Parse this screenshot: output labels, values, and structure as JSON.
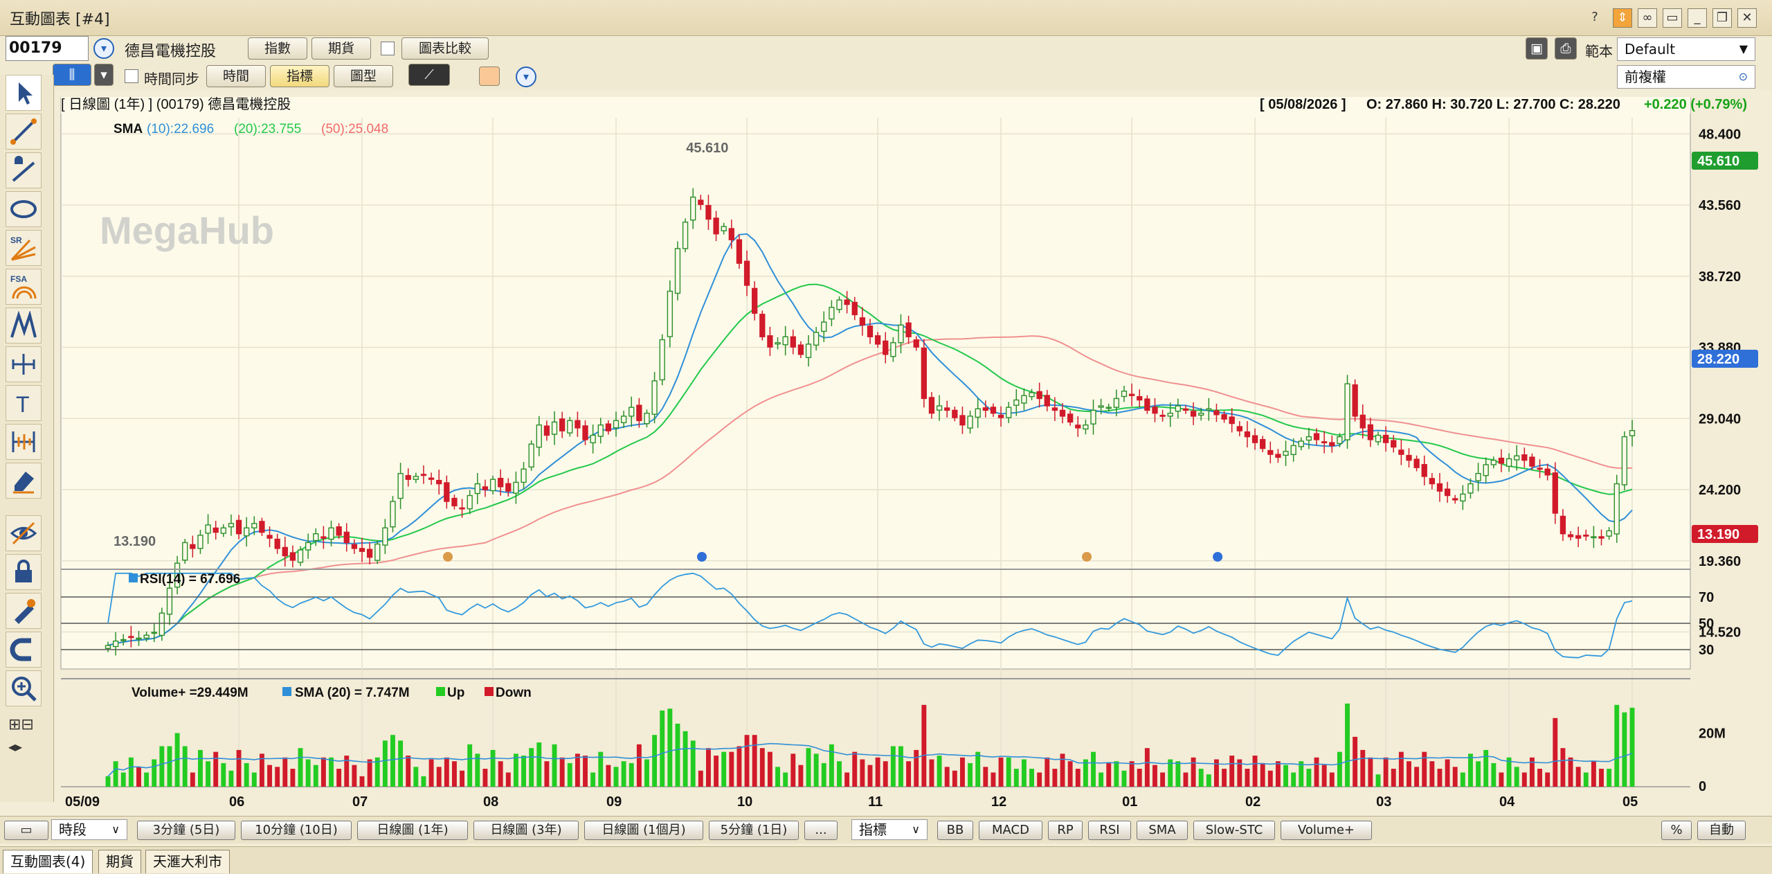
{
  "window": {
    "title": "互動圖表 [#4]"
  },
  "toolbar": {
    "code": "00179",
    "stock_name": "德昌電機控股",
    "btn_indicators": "指數",
    "btn_futures": "期貨",
    "btn_compare": "圖表比較",
    "template_label": "範本",
    "template_value": "Default",
    "adjust_value": "前複權",
    "time_sync": "時間同步",
    "btn_time": "時間",
    "btn_indicator": "指標",
    "btn_pattern": "圖型"
  },
  "chart_header": {
    "left": "[ 日線圖 (1年) ]  (00179)  德昌電機控股",
    "date": "[ 05/08/2026 ]",
    "ohlc": "O: 27.860  H: 30.720  L: 27.700  C: 28.220",
    "change": "+0.220 (+0.79%)",
    "watermark": "MegaHub"
  },
  "sma_legend": {
    "label": "SMA",
    "p10": "(10):22.696",
    "p20": "(20):23.755",
    "p50": "(50):25.048"
  },
  "rsi_legend": "RSI(14) = 67.696",
  "vol_legend": {
    "main": "Volume+ =29.449M",
    "sma": "SMA (20) = 7.747M",
    "up": "Up",
    "down": "Down"
  },
  "bottom": {
    "period_select": "時段",
    "periods": [
      "3分鐘 (5日)",
      "10分鐘 (10日)",
      "日線圖 (1年)",
      "日線圖 (3年)",
      "日線圖 (1個月)",
      "5分鐘 (1日)",
      "..."
    ],
    "indicator_select": "指標",
    "indicators": [
      "BB",
      "MACD",
      "RP",
      "RSI",
      "SMA",
      "Slow-STC",
      "Volume+"
    ],
    "pct": "%",
    "auto": "自動"
  },
  "tabs": [
    "互動圖表(4)",
    "期貨",
    "天滙大利市"
  ],
  "colors": {
    "up": "#22cc22",
    "down": "#d11a2a",
    "sma10": "#2f8fd8",
    "sma20": "#22c84a",
    "sma50": "#f09090",
    "rsi": "#3399dd",
    "bg": "#fdfae9",
    "last_price_tag": "#2f6fd8",
    "high_tag": "#1f9e2f",
    "low_tag": "#d11a2a"
  },
  "chart_data": {
    "type": "candlestick",
    "title": "德昌電機控股 (00179) 日線圖 (1年)",
    "x_ticks": [
      "05/09",
      "06",
      "07",
      "08",
      "09",
      "10",
      "11",
      "12",
      "01",
      "02",
      "03",
      "04",
      "05"
    ],
    "y_ticks": [
      14.52,
      19.36,
      24.2,
      29.04,
      33.88,
      38.72,
      43.56,
      48.4
    ],
    "y_tick_labels": [
      "14.520",
      "19.360",
      "24.200",
      "29.040",
      "33.880",
      "38.720",
      "43.560",
      "48.400"
    ],
    "ylim": [
      12.0,
      49.5
    ],
    "high_label": "45.610",
    "low_label": "13.190",
    "last_price": 28.22,
    "last_price_label": "28.220",
    "series": [
      {
        "name": "Close",
        "values": [
          13.6,
          13.9,
          14.0,
          14.2,
          14.1,
          14.3,
          14.5,
          15.8,
          17.5,
          19.2,
          20.6,
          20.2,
          21.1,
          21.8,
          21.3,
          21.6,
          21.9,
          21.2,
          21.6,
          21.9,
          21.3,
          20.9,
          20.2,
          19.7,
          19.4,
          20.1,
          20.6,
          21.2,
          20.9,
          21.6,
          21.1,
          20.6,
          20.2,
          20.0,
          19.6,
          20.5,
          21.6,
          23.4,
          25.3,
          24.9,
          25.1,
          25.2,
          24.9,
          24.6,
          23.4,
          23.1,
          22.9,
          23.8,
          24.6,
          24.2,
          24.9,
          24.4,
          24.1,
          24.7,
          25.6,
          27.3,
          28.6,
          27.9,
          28.8,
          28.2,
          28.9,
          28.4,
          27.6,
          27.9,
          28.6,
          28.2,
          28.9,
          29.2,
          29.8,
          28.9,
          29.4,
          31.6,
          34.4,
          37.7,
          40.6,
          42.4,
          44.1,
          43.6,
          42.6,
          41.6,
          42.1,
          41.2,
          39.6,
          38.1,
          36.2,
          34.6,
          33.9,
          34.2,
          34.6,
          33.9,
          33.4,
          34.1,
          34.9,
          35.6,
          36.6,
          37.1,
          36.8,
          36.1,
          35.4,
          34.6,
          34.1,
          33.4,
          34.2,
          35.4,
          34.6,
          33.9,
          30.4,
          29.4,
          29.9,
          29.6,
          29.1,
          28.6,
          29.2,
          29.7,
          29.6,
          29.4,
          29.1,
          29.8,
          30.3,
          30.6,
          30.8,
          30.4,
          29.9,
          29.6,
          29.2,
          28.8,
          28.4,
          28.6,
          29.6,
          29.9,
          29.8,
          30.4,
          30.9,
          30.6,
          30.3,
          29.6,
          29.4,
          29.2,
          29.4,
          29.9,
          29.6,
          29.2,
          29.4,
          29.7,
          29.3,
          29.0,
          28.7,
          28.2,
          27.8,
          27.4,
          27.0,
          26.6,
          26.4,
          26.8,
          27.2,
          27.5,
          27.8,
          27.6,
          27.4,
          27.2,
          27.8,
          31.4,
          29.2,
          28.4,
          27.6,
          27.9,
          27.4,
          27.1,
          26.6,
          26.2,
          25.7,
          25.1,
          24.6,
          24.1,
          23.8,
          23.5,
          23.9,
          24.6,
          25.3,
          25.9,
          26.2,
          26.0,
          26.3,
          26.5,
          26.2,
          25.8,
          25.6,
          25.2,
          22.6,
          21.2,
          21.0,
          20.9,
          21.1,
          21.0,
          20.9,
          21.4,
          24.6,
          27.8,
          28.22
        ]
      },
      {
        "name": "SMA (10)",
        "values": []
      },
      {
        "name": "SMA (20)",
        "values": []
      },
      {
        "name": "SMA (50)",
        "values": []
      }
    ],
    "rsi": {
      "name": "RSI(14)",
      "levels": [
        70,
        50,
        30
      ],
      "last": 67.696
    },
    "volume": {
      "name": "Volume+",
      "unit": "M",
      "y_ticks": [
        "20M",
        "0"
      ],
      "last": 29.449,
      "sma20_last": 7.747
    },
    "event_markers": [
      {
        "date": "07",
        "color": "#d99a4a"
      },
      {
        "date": "09",
        "color": "#2f6fd8"
      },
      {
        "date": "12",
        "color": "#d99a4a"
      },
      {
        "date": "01",
        "color": "#2f6fd8"
      }
    ]
  }
}
